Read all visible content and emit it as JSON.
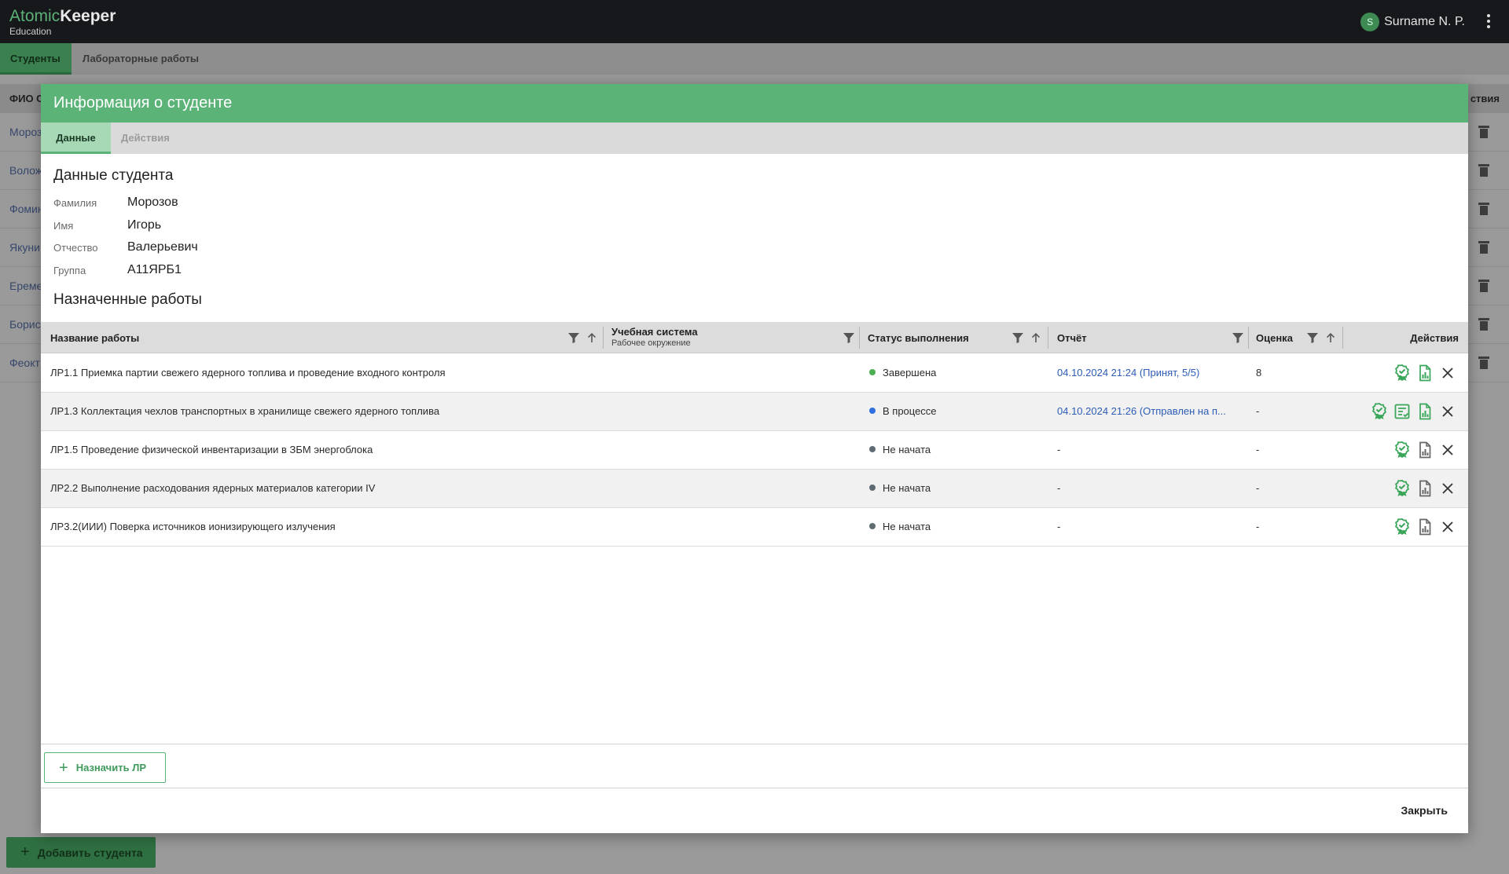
{
  "app": {
    "logo_part1": "Atomic",
    "logo_part2": "Keeper",
    "logo_sub": "Education",
    "user_initial": "S",
    "user_name": "Surname N. P."
  },
  "app_tabs": [
    "Студенты",
    "Лабораторные работы"
  ],
  "background_table": {
    "header_fio": "ФИО С",
    "header_actions": "ствия",
    "names": [
      "Мороз",
      "Волож",
      "Фомин",
      "Якуни",
      "Ереме",
      "Борис",
      "Феокт"
    ]
  },
  "add_student_label": "Добавить студента",
  "modal": {
    "title": "Информация о студенте",
    "tabs": [
      "Данные",
      "Действия"
    ],
    "student_section_title": "Данные студента",
    "fields": [
      {
        "label": "Фамилия",
        "value": "Морозов"
      },
      {
        "label": "Имя",
        "value": "Игорь"
      },
      {
        "label": "Отчество",
        "value": "Валерьевич"
      },
      {
        "label": "Группа",
        "value": "А11ЯРБ1"
      }
    ],
    "works_section_title": "Назначенные работы",
    "columns": {
      "name": "Название работы",
      "system": "Учебная система",
      "system_sub": "Рабочее окружение",
      "status": "Статус выполнения",
      "report": "Отчёт",
      "grade": "Оценка",
      "actions": "Действия"
    },
    "rows": [
      {
        "name": "ЛР1.1 Приемка партии свежего ядерного топлива и проведение входного контроля",
        "url": "https://r1e1tu1.atomickeepereducation.l...",
        "status": "Завершена",
        "status_color": "#4caf50",
        "report": "04.10.2024 21:24 (Принят, 5/5)",
        "grade": "8",
        "actions": [
          "award-icon",
          "report-chart-icon",
          "close-icon"
        ]
      },
      {
        "name": "ЛР1.3 Коллектация чехлов транспортных в хранилище свежего ядерного топлива",
        "url": "https://r1e3tu2.atomickeepereducation.l...",
        "status": "В процессе",
        "status_color": "#2f6fe0",
        "report": "04.10.2024 21:26 (Отправлен на п...",
        "grade": "-",
        "actions": [
          "award-icon",
          "review-icon",
          "report-chart-icon",
          "close-icon"
        ]
      },
      {
        "name": "ЛР1.5 Проведение физической инвентаризации в ЗБМ энергоблока",
        "url": "https://r1e5tu3.atomickeepereducation.l...",
        "status": "Не начата",
        "status_color": "#5f6b73",
        "report": "-",
        "grade": "-",
        "actions": [
          "award-icon",
          "report-chart-icon",
          "close-icon"
        ]
      },
      {
        "name": "ЛР2.2 Выполнение расходования ядерных материалов категории IV",
        "url": "https://r2e2tu4.atomickeepereducation.l...",
        "status": "Не начата",
        "status_color": "#5f6b73",
        "report": "-",
        "grade": "-",
        "actions": [
          "award-icon",
          "report-chart-icon",
          "close-icon"
        ]
      },
      {
        "name": "ЛР3.2(ИИИ) Поверка источников ионизирующего излучения",
        "url": "https://r2e13tu5.atomickeepereducation....",
        "status": "Не начата",
        "status_color": "#5f6b73",
        "report": "-",
        "grade": "-",
        "actions": [
          "award-icon",
          "report-chart-icon",
          "close-icon"
        ]
      }
    ],
    "assign_label": "Назначить ЛР",
    "close_label": "Закрыть"
  },
  "colors": {
    "accent": "#5bb378",
    "header_dark": "#17181b",
    "link": "#2d5cb6"
  }
}
